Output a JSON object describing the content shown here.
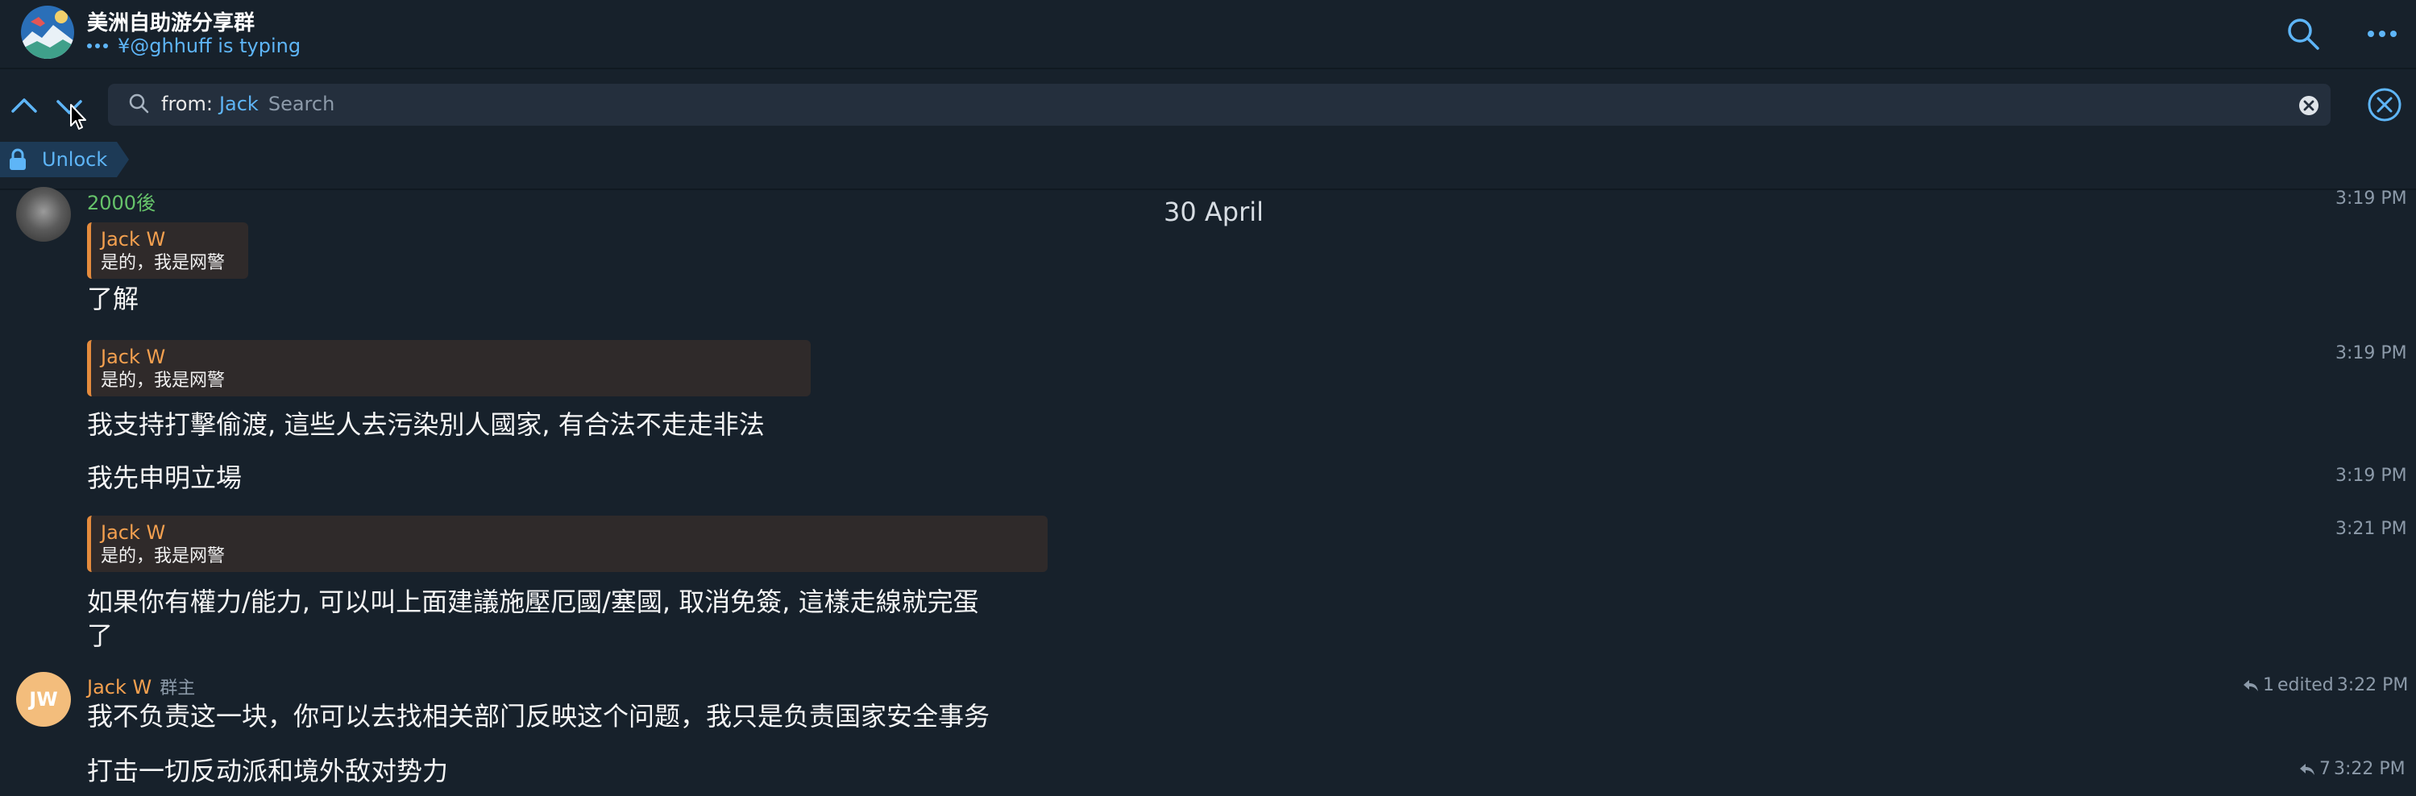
{
  "header": {
    "title": "美洲自助游分享群",
    "status": "¥@ghhuff is typing"
  },
  "search": {
    "from_label": "from:",
    "user": "Jack",
    "placeholder": "Search"
  },
  "unlock_label": "Unlock",
  "date_label": "30 April",
  "messages": [
    {
      "sender": "2000後",
      "reply": {
        "name": "Jack W",
        "text": "是的，我是网警"
      },
      "text": "了解",
      "time": "3:19 PM"
    },
    {
      "reply": {
        "name": "Jack W",
        "text": "是的，我是网警"
      },
      "text": "我支持打擊偷渡, 這些人去污染別人國家, 有合法不走走非法",
      "time": "3:19 PM"
    },
    {
      "text": "我先申明立場",
      "time": "3:19 PM"
    },
    {
      "reply": {
        "name": "Jack W",
        "text": "是的，我是网警"
      },
      "text_line1": "如果你有權力/能力, 可以叫上面建議施壓厄國/塞國, 取消免簽, 這樣走線就完蛋",
      "text_line2": "了",
      "time": "3:21 PM"
    },
    {
      "sender": "Jack W",
      "role": "群主",
      "avatar_initials": "JW",
      "text": "我不负责这一块，你可以去找相关部门反映这个问题，我只是负责国家安全事务",
      "replies": "1",
      "edited": "edited",
      "time": "3:22 PM"
    },
    {
      "text": "打击一切反动派和境外敌对势力",
      "replies": "7",
      "time": "3:22 PM"
    }
  ],
  "colors": {
    "background": "#17212b",
    "accent": "#5eb5f7",
    "sender_green": "#66c36a",
    "sender_orange": "#f4a04f",
    "reply_bar": "#e58b3d"
  },
  "icons": {
    "header_search": "search-icon",
    "header_menu": "more-horizontal-icon",
    "prev": "chevron-up-icon",
    "next": "chevron-down-icon",
    "search_field": "magnifier-icon",
    "clear": "clear-icon",
    "close": "close-circle-icon",
    "lock": "lock-icon",
    "reply_count": "reply-arrow-icon"
  }
}
